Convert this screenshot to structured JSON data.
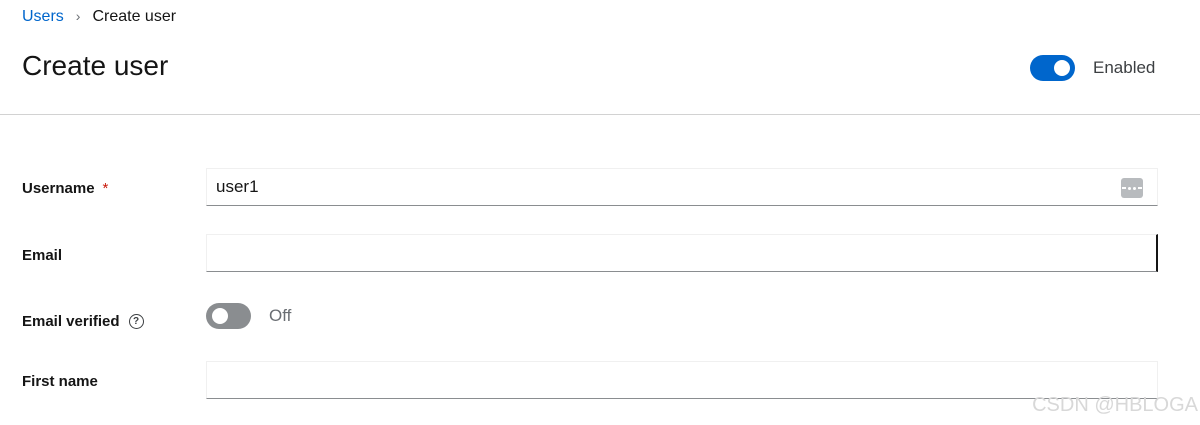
{
  "breadcrumb": {
    "parent": "Users",
    "separator": "›",
    "current": "Create user"
  },
  "header": {
    "title": "Create user",
    "enabled_label": "Enabled",
    "enabled": true
  },
  "form": {
    "username": {
      "label": "Username",
      "required_marker": "*",
      "value": "user1"
    },
    "email": {
      "label": "Email",
      "value": ""
    },
    "email_verified": {
      "label": "Email verified",
      "help_icon": "?",
      "state_label": "Off",
      "value": false
    },
    "first_name": {
      "label": "First name",
      "value": ""
    }
  },
  "watermark": "CSDN @HBLOGA",
  "colors": {
    "accent": "#0066cc",
    "required": "#c9190b",
    "toggle_off": "#8a8d90"
  },
  "icons": {
    "breadcrumb_separator": "chevron-right-icon",
    "password_manager": "password-manager-icon",
    "help": "question-circle-icon"
  }
}
